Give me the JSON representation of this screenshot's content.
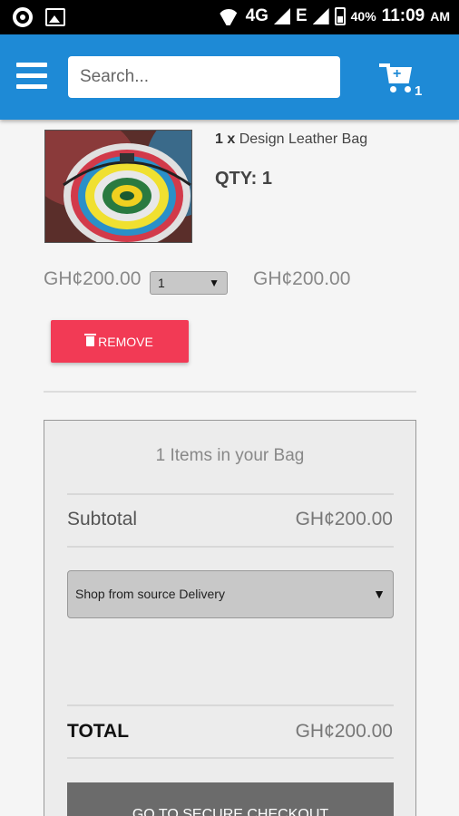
{
  "status_bar": {
    "network": "4G",
    "network_secondary": "E",
    "battery": "40%",
    "time": "11:09",
    "time_suffix": "AM"
  },
  "header": {
    "search_placeholder": "Search...",
    "cart_count": "1"
  },
  "cart_item": {
    "quantity_prefix": "1 x",
    "name": "Design Leather Bag",
    "qty_label": "QTY: 1",
    "unit_price": "GH¢200.00",
    "qty_selected": "1",
    "line_total": "GH¢200.00",
    "remove_label": "REMOVE"
  },
  "summary": {
    "items_text": "1 Items in your Bag",
    "subtotal_label": "Subtotal",
    "subtotal_value": "GH¢200.00",
    "delivery_selected": "Shop from source Delivery",
    "total_label": "TOTAL",
    "total_value": "GH¢200.00",
    "checkout_label": "GO TO SECURE CHECKOUT"
  },
  "colors": {
    "app_bar": "#1e8ad6",
    "remove_button": "#f23a55",
    "checkout_button": "#6b6b6b"
  }
}
